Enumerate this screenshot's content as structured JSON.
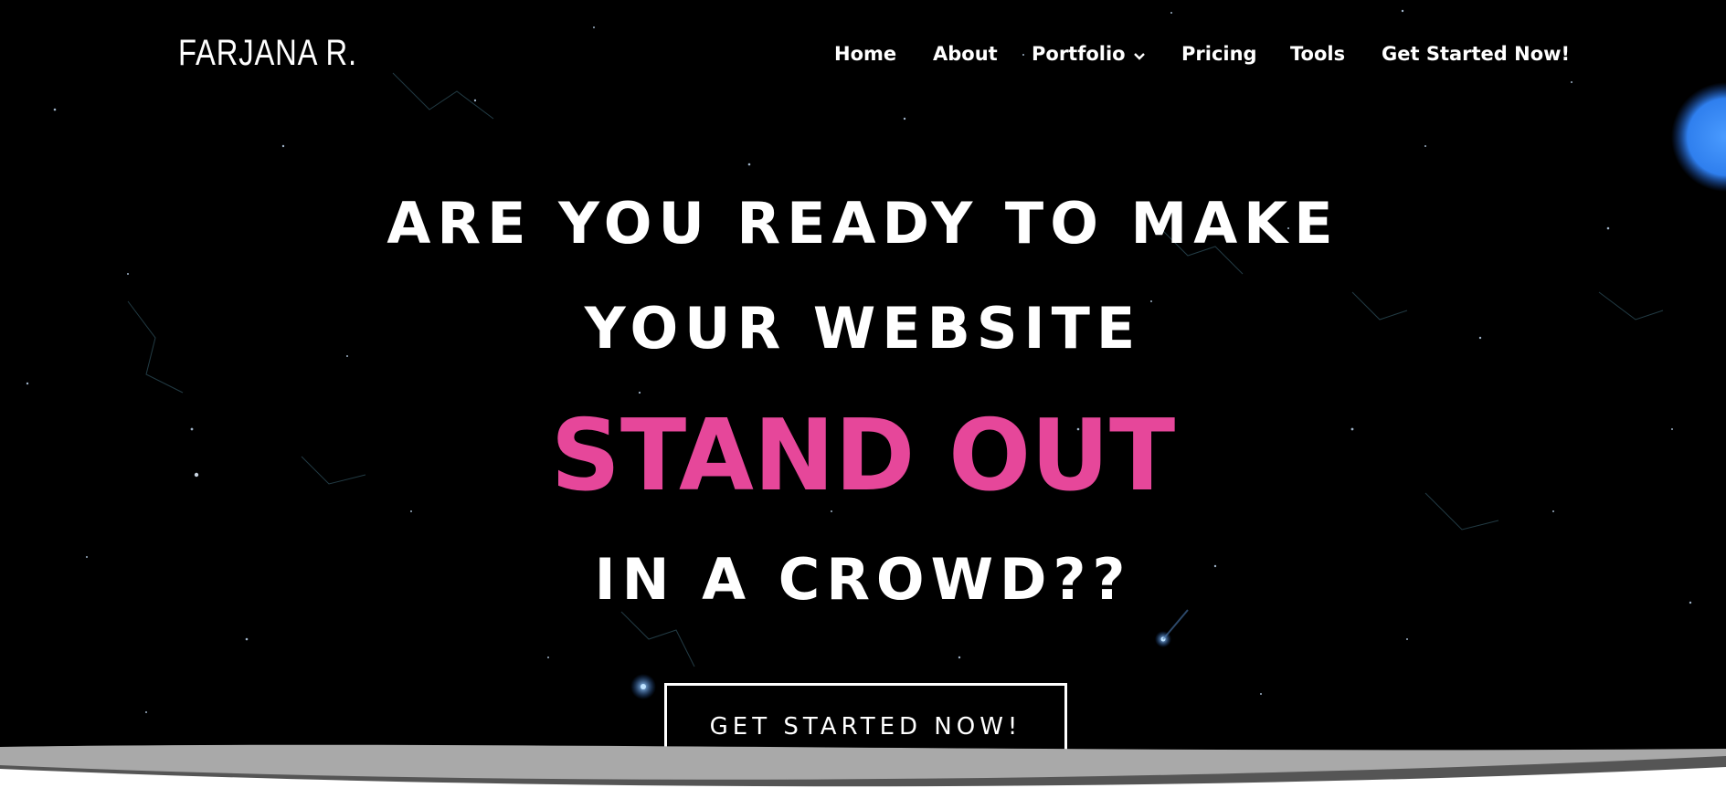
{
  "logo": {
    "text": "FARJANA R."
  },
  "nav": {
    "items": [
      {
        "label": "Home"
      },
      {
        "label": "About"
      },
      {
        "label": "Portfolio"
      },
      {
        "label": "Pricing"
      },
      {
        "label": "Tools"
      },
      {
        "label": "Get Started Now!"
      }
    ],
    "dropdown_icon": "chevron-down-icon"
  },
  "hero": {
    "line1": "ARE YOU READY TO MAKE",
    "line2": "YOUR WEBSITE",
    "line3": "STAND OUT",
    "line4": "IN A CROWD??",
    "cta_label": "GET STARTED NOW!"
  },
  "colors": {
    "background": "#000000",
    "accent_pink": "#e6479a",
    "text": "#ffffff",
    "planet": "#3d8cf5",
    "wave_light": "#a9a9a9",
    "wave_dark": "#555555"
  }
}
